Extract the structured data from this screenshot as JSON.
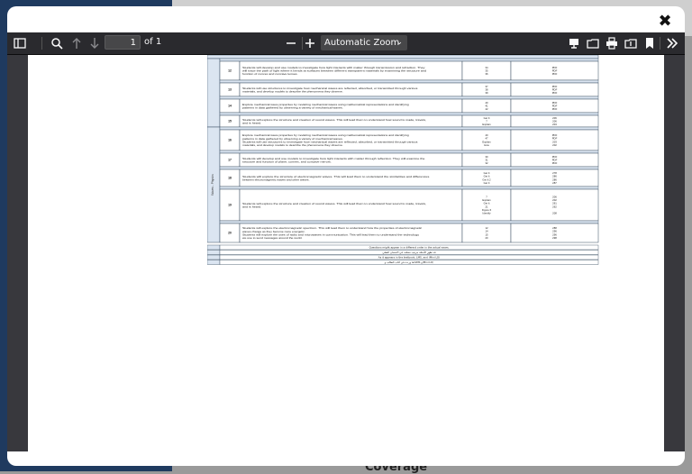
{
  "background": {
    "heading": "Coverage"
  },
  "viewer": {
    "page_number": "1",
    "page_total": "of 1",
    "zoom": "Automatic Zoom"
  },
  "document": {
    "side_label": "Waves - Physics",
    "rows": [
      {
        "no": "12",
        "text": [
          "Students will develop and use models to investigate how light interacts with matter through transmission and refraction. They",
          "will trace the path of light where it bends at surfaces between different transparent materials by examining the structure and",
          "function of convex and concave lenses."
        ],
        "pages": [
          "34",
          "35",
          "36"
        ],
        "types": [
          "PDF",
          "PDF",
          "PDF"
        ]
      },
      {
        "no": "13",
        "text": [
          "Students will use structures to investigate how mechanical waves are reflected, absorbed, or transmitted through various",
          "materials, and develop models to describe the phenomena they observe."
        ],
        "pages": [
          "37",
          "38",
          "39"
        ],
        "types": [
          "PDF",
          "PDF",
          "PDF"
        ]
      },
      {
        "no": "14",
        "text": [
          "Explore mechanical wave properties by modeling mechanical waves using mathematical representations and identifying",
          "patterns in data gathered by observing a variety of mechanical waves."
        ],
        "pages": [
          "40",
          "41",
          "42"
        ],
        "types": [
          "PDF",
          "PDF",
          "PDF"
        ]
      },
      {
        "no": "15",
        "text": [
          "Students will explore the structure and creation of sound waves. This will lead them to understand how sound is made, travels,",
          "and is heard."
        ],
        "pages": [
          "Get It",
          "7",
          "Explain"
        ],
        "types": [
          "206",
          "206",
          "204"
        ]
      },
      {
        "no": "16",
        "text": [
          "Explore mechanical wave properties by modeling mechanical waves using mathematical representations and identifying",
          "patterns in data gathered by observing a variety of mechanical waves.",
          "Students will use structures to investigate how mechanical waves are reflected, absorbed, or transmitted through various",
          "materials, and develop models to describe the phenomena they observe."
        ],
        "pages": [
          "40",
          "47",
          "Explain",
          "How"
        ],
        "types": [
          "PDF",
          "PDF",
          "203",
          "202"
        ]
      },
      {
        "no": "17",
        "text": [
          "Students will develop and use models to investigate how light interacts with matter through reflection. They will examine the",
          "structure and function of plane, convex, and concave mirrors."
        ],
        "pages": [
          "30",
          "31",
          "32"
        ],
        "types": [
          "PDF",
          "PDF",
          "PDF"
        ]
      },
      {
        "no": "18",
        "text": [
          "Students will explore the structure of electromagnetic waves. This will lead them to understand the similarities and differences",
          "between electromagnetic waves and other waves."
        ],
        "pages": [
          "Get It",
          "Get It",
          "Get It 2",
          "Get It"
        ],
        "types": [
          "278",
          "286",
          "286",
          "287"
        ]
      },
      {
        "no": "19",
        "text": [
          "Students will explore the structure and creation of sound waves. This will lead them to understand how sound is made, travels,",
          "and is heard."
        ],
        "pages": [
          "7",
          "Explain",
          "Get It",
          "21",
          "Figure 6",
          "Identify"
        ],
        "types": [
          "206",
          "202",
          "261",
          "262",
          "",
          "208"
        ]
      },
      {
        "no": "20",
        "text": [
          "Students will explore the electromagnetic spectrum. This will lead them to understand how the properties of electromagnetic",
          "waves change as they become more energetic.",
          "Students will explore the uses of radio and microwaves in communication. This will lead them to understand the technology",
          "we use to send messages around the world."
        ],
        "pages": [
          "12",
          "14",
          "15",
          "20"
        ],
        "types": [
          "288",
          "296",
          "296",
          "298"
        ]
      }
    ],
    "footnotes": [
      "Questions might appear in a different order in the actual exam.",
      "قد تظهر الأسئلة بترتيب مختلف في الامتحان الفعلي",
      "As it appears in the textbook, LMS, and (Mini LO)",
      "كما وردت في كتاب الطالب وLMS و(Mini LO)"
    ]
  }
}
